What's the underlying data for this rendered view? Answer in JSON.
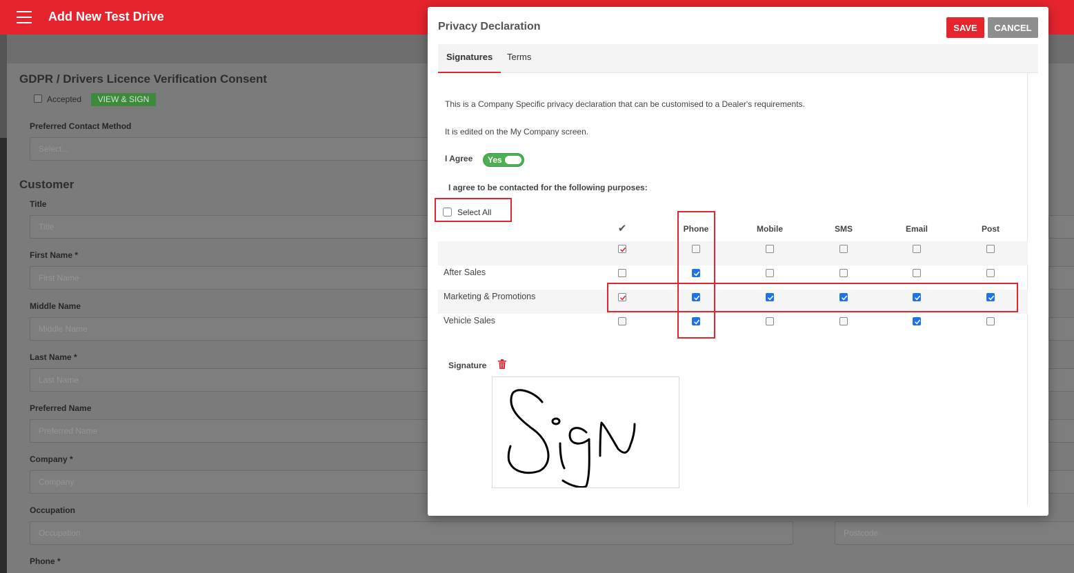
{
  "app": {
    "title": "Add New Test Drive"
  },
  "background": {
    "consent_heading": "GDPR / Drivers Licence Verification Consent",
    "accepted_label": "Accepted",
    "view_sign_label": "VIEW & SIGN",
    "preferred_contact_label": "Preferred Contact Method",
    "preferred_contact_placeholder": "Select...",
    "customer_heading": "Customer",
    "fields": [
      {
        "label": "Title",
        "placeholder": "Title"
      },
      {
        "label": "First Name *",
        "placeholder": "First Name"
      },
      {
        "label": "Middle Name",
        "placeholder": "Middle Name"
      },
      {
        "label": "Last Name *",
        "placeholder": "Last Name"
      },
      {
        "label": "Preferred Name",
        "placeholder": "Preferred Name"
      },
      {
        "label": "Company *",
        "placeholder": "Company"
      },
      {
        "label": "Occupation",
        "placeholder": "Occupation"
      }
    ],
    "postcode_placeholder": "Postcode",
    "phone_label": "Phone *"
  },
  "modal": {
    "title": "Privacy Declaration",
    "save_label": "SAVE",
    "cancel_label": "CANCEL",
    "tabs": [
      {
        "label": "Signatures",
        "active": true
      },
      {
        "label": "Terms",
        "active": false
      }
    ],
    "intro": "This is a Company Specific privacy declaration that can be customised to a Dealer's requirements.",
    "edited_note": "It is edited on the My Company screen.",
    "agree_label": "I Agree",
    "agree_toggle": "Yes",
    "purposes_label": "I agree to be contacted for the following purposes:",
    "select_all_label": "Select All",
    "columns": [
      "Phone",
      "Mobile",
      "SMS",
      "Email",
      "Post"
    ],
    "rows": [
      {
        "label": "",
        "values": [
          "red",
          "off",
          "off",
          "off",
          "off",
          "off"
        ]
      },
      {
        "label": "After Sales",
        "values": [
          "off",
          "blue",
          "off",
          "off",
          "off",
          "off"
        ]
      },
      {
        "label": "Marketing & Promotions",
        "values": [
          "red",
          "blue",
          "blue",
          "blue",
          "blue",
          "blue"
        ]
      },
      {
        "label": "Vehicle Sales",
        "values": [
          "off",
          "blue",
          "off",
          "off",
          "blue",
          "off"
        ]
      }
    ],
    "signature_label": "Signature"
  },
  "colors": {
    "brand": "#e5242d",
    "toggle": "#4caf50",
    "checkbox": "#1e73e8"
  }
}
